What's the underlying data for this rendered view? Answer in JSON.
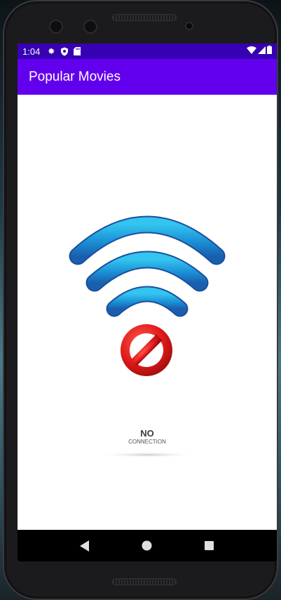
{
  "status_bar": {
    "time": "1:04",
    "icons": [
      "gear-icon",
      "shield-icon",
      "sd-card-icon",
      "wifi-icon",
      "cell-signal-icon",
      "battery-icon"
    ]
  },
  "app_bar": {
    "title": "Popular Movies"
  },
  "illustration": {
    "icons": [
      "wifi-icon",
      "no-entry-icon"
    ],
    "label_main": "NO",
    "label_sub": "CONNECTION"
  },
  "nav_bar": {
    "icons": [
      "back-icon",
      "home-icon",
      "recents-icon"
    ]
  },
  "colors": {
    "status_bar": "#3700b3",
    "app_bar": "#6200ee",
    "wifi_blue": "#1a90d8",
    "stop_red": "#e11b1b"
  }
}
